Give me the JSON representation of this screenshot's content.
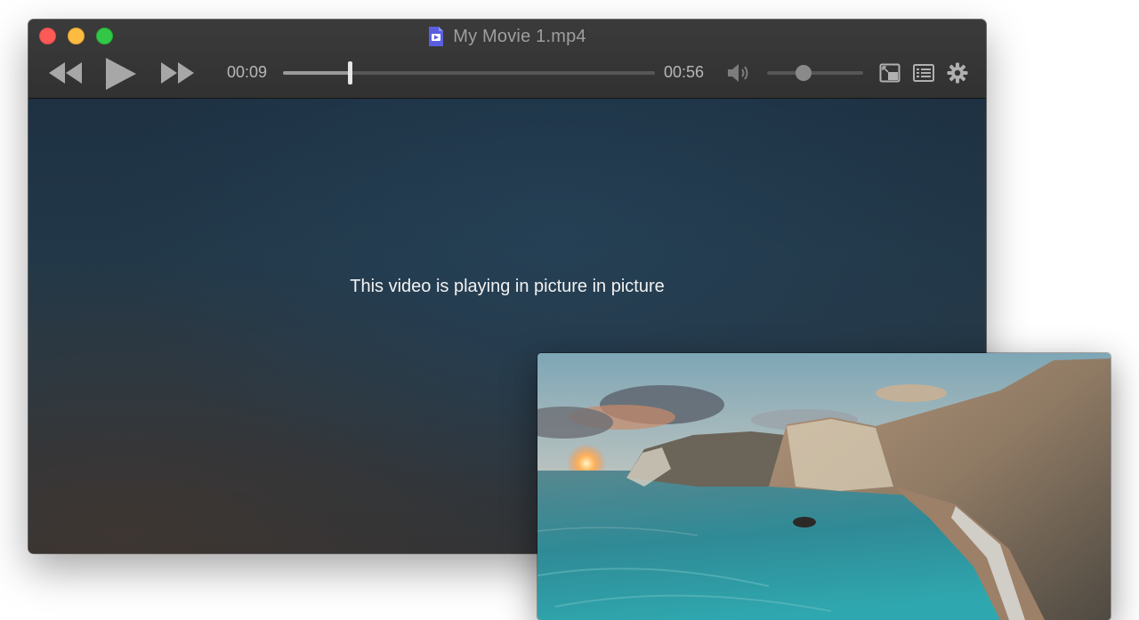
{
  "window": {
    "title": "My Movie 1.mp4",
    "controls": {
      "rewind_icon": "rewind-icon",
      "play_icon": "play-icon",
      "fast_forward_icon": "fast-forward-icon",
      "current_time": "00:09",
      "duration": "00:56",
      "progress": 0.18,
      "volume_icon": "speaker-icon",
      "volume": 0.38,
      "pip_icon": "picture-in-picture-icon",
      "playlist_icon": "playlist-icon",
      "settings_icon": "gear-icon"
    },
    "video": {
      "message": "This video is playing in picture in picture"
    }
  },
  "pip": {
    "content": "coastal-cliffs-sunset-scene"
  },
  "colors": {
    "traffic_close": "#fc5a57",
    "traffic_minimize": "#fdbc40",
    "traffic_zoom": "#33c748",
    "doc_icon": "#5a5fe0"
  }
}
